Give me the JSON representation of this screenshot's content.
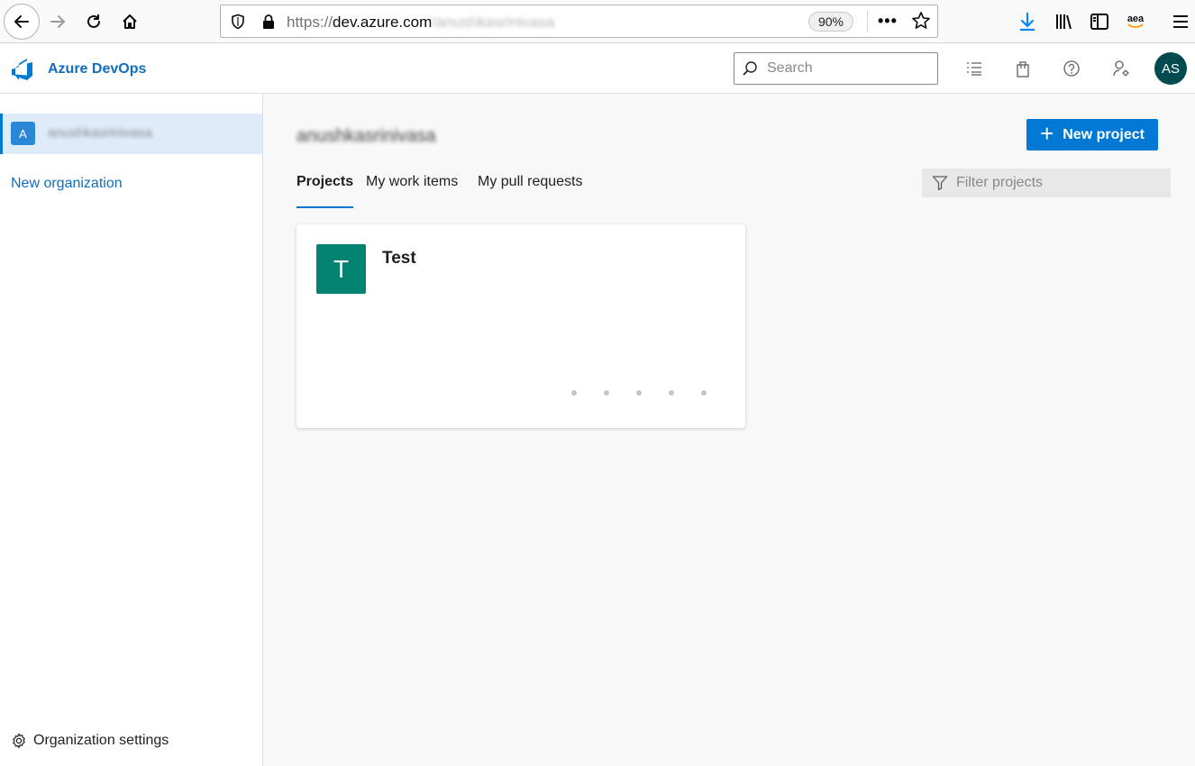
{
  "browser": {
    "url_protocol": "https://",
    "url_domain": "dev.azure.com",
    "url_path": "/anushkasrinivasa",
    "zoom": "90%",
    "more_label": "•••",
    "extension_label": "aea"
  },
  "header": {
    "app_title": "Azure DevOps",
    "search_placeholder": "Search",
    "user_initials": "AS"
  },
  "sidebar": {
    "org_initial": "A",
    "org_name": "anushkasrinivasa",
    "new_org_label": "New organization",
    "settings_label": "Organization settings"
  },
  "main": {
    "org_title": "anushkasrinivasa",
    "new_project_label": "New project",
    "tabs": [
      {
        "label": "Projects",
        "active": true
      },
      {
        "label": "My work items",
        "active": false
      },
      {
        "label": "My pull requests",
        "active": false
      }
    ],
    "filter_placeholder": "Filter projects",
    "projects": [
      {
        "initial": "T",
        "name": "Test",
        "color": "#038272"
      }
    ]
  },
  "colors": {
    "accent": "#0078d4",
    "brand": "#106ebe",
    "avatar": "#004b50"
  }
}
